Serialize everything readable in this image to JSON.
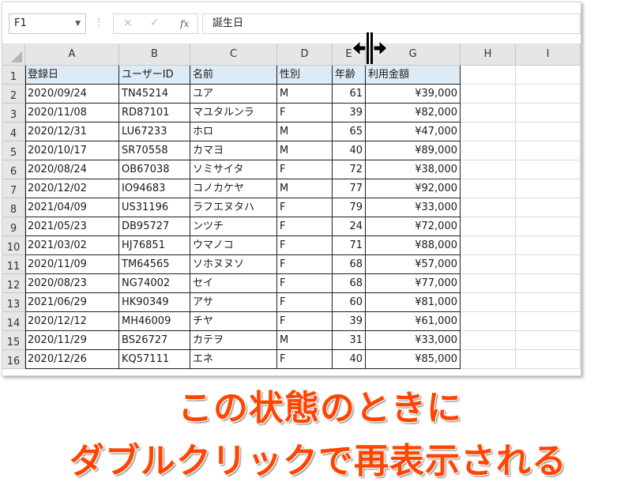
{
  "formula_bar": {
    "name_box": "F1",
    "cancel_icon": "×",
    "enter_icon": "✓",
    "fx_label": "fx",
    "formula": "誕生日"
  },
  "columns": [
    "A",
    "B",
    "C",
    "D",
    "E",
    "G",
    "H",
    "I"
  ],
  "rows": [
    "1",
    "2",
    "3",
    "4",
    "5",
    "6",
    "7",
    "8",
    "9",
    "10",
    "11",
    "12",
    "13",
    "14",
    "15",
    "16"
  ],
  "table": {
    "headers": [
      "登録日",
      "ユーザーID",
      "名前",
      "性別",
      "年齢",
      "利用金額"
    ],
    "rows": [
      [
        "2020/09/24",
        "TN45214",
        "ユア",
        "M",
        "61",
        "¥39,000"
      ],
      [
        "2020/11/08",
        "RD87101",
        "マユタルンラ",
        "F",
        "39",
        "¥82,000"
      ],
      [
        "2020/12/31",
        "LU67233",
        "ホロ",
        "M",
        "65",
        "¥47,000"
      ],
      [
        "2020/10/17",
        "SR70558",
        "カマヨ",
        "M",
        "40",
        "¥89,000"
      ],
      [
        "2020/08/24",
        "OB67038",
        "ソミサイタ",
        "F",
        "72",
        "¥38,000"
      ],
      [
        "2020/12/02",
        "IO94683",
        "コノカケヤ",
        "M",
        "77",
        "¥92,000"
      ],
      [
        "2021/04/09",
        "US31196",
        "ラフエヌタハ",
        "F",
        "79",
        "¥33,000"
      ],
      [
        "2021/05/23",
        "DB95727",
        "ンツチ",
        "F",
        "24",
        "¥72,000"
      ],
      [
        "2021/03/02",
        "HJ76851",
        "ウマノコ",
        "F",
        "71",
        "¥88,000"
      ],
      [
        "2020/11/09",
        "TM64565",
        "ソホヌヌソ",
        "F",
        "68",
        "¥57,000"
      ],
      [
        "2020/08/23",
        "NG74002",
        "セイ",
        "F",
        "68",
        "¥77,000"
      ],
      [
        "2021/06/29",
        "HK90349",
        "アサ",
        "F",
        "60",
        "¥81,000"
      ],
      [
        "2020/12/12",
        "MH46009",
        "チヤ",
        "F",
        "39",
        "¥61,000"
      ],
      [
        "2020/11/29",
        "BS26727",
        "カテヲ",
        "M",
        "31",
        "¥33,000"
      ],
      [
        "2020/12/26",
        "KQ57111",
        "エネ",
        "F",
        "40",
        "¥85,000"
      ]
    ]
  },
  "caption": {
    "line1": "この状態のときに",
    "line2": "ダブルクリックで再表示される"
  },
  "colors": {
    "header_fill": "#ddebf7",
    "caption": "#ff4500"
  }
}
